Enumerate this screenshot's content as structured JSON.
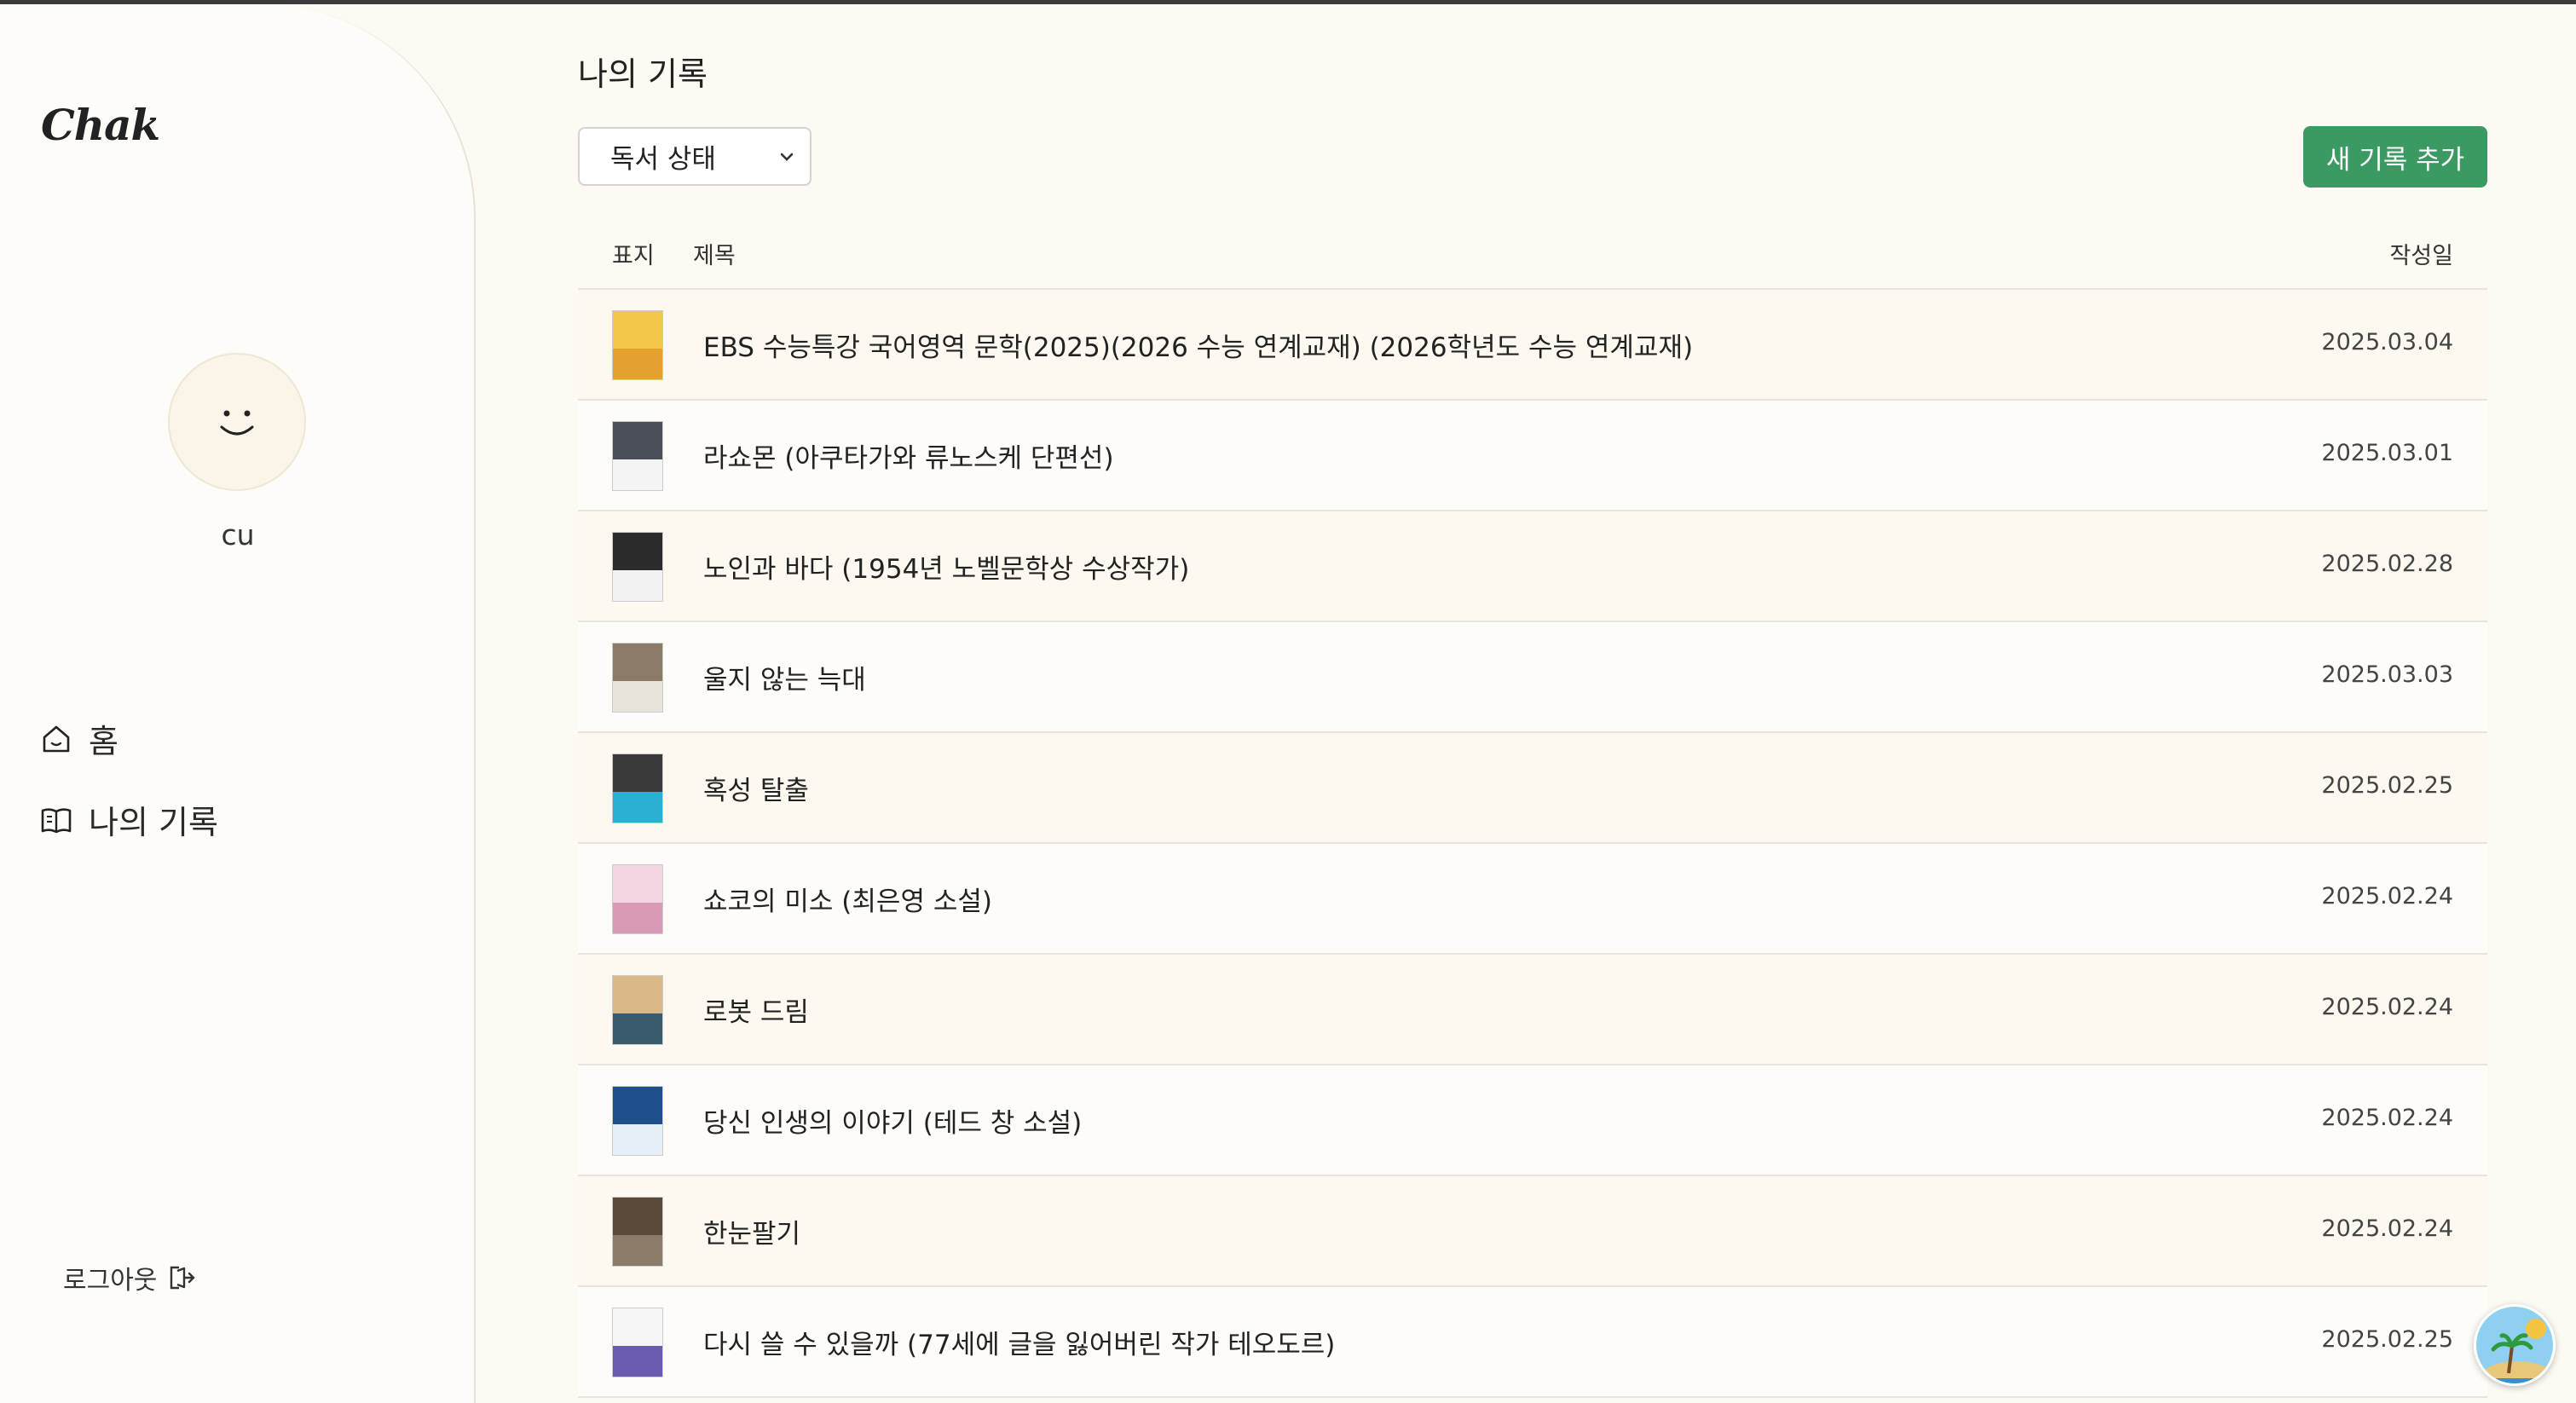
{
  "app": {
    "logo": "Chak"
  },
  "sidebar": {
    "username": "cu",
    "nav": [
      {
        "label": "홈",
        "icon": "home-icon"
      },
      {
        "label": "나의 기록",
        "icon": "book-open-icon"
      }
    ],
    "logout_label": "로그아웃"
  },
  "main": {
    "title": "나의 기록",
    "filter": {
      "selected": "독서 상태"
    },
    "add_button": "새 기록 추가",
    "columns": {
      "cover": "표지",
      "title": "제목",
      "date": "작성일"
    },
    "rows": [
      {
        "title": "EBS 수능특강 국어영역 문학(2025)(2026 수능 연계교재) (2026학년도 수능 연계교재)",
        "date": "2025.03.04",
        "cover_colors": [
          "#f2c84b",
          "#e3a12f"
        ]
      },
      {
        "title": "라쇼몬 (아쿠타가와 류노스케 단편선)",
        "date": "2025.03.01",
        "cover_colors": [
          "#4b4f5a",
          "#f4f4f4"
        ]
      },
      {
        "title": "노인과 바다 (1954년 노벨문학상 수상작가)",
        "date": "2025.02.28",
        "cover_colors": [
          "#2b2b2b",
          "#f2f2f2"
        ]
      },
      {
        "title": "울지 않는 늑대",
        "date": "2025.03.03",
        "cover_colors": [
          "#8a7a66",
          "#e9e4da"
        ]
      },
      {
        "title": "혹성 탈출",
        "date": "2025.02.25",
        "cover_colors": [
          "#3a3a3a",
          "#2bb0d4"
        ]
      },
      {
        "title": "쇼코의 미소 (최은영 소설)",
        "date": "2025.02.24",
        "cover_colors": [
          "#f3d6e2",
          "#d99ab5"
        ]
      },
      {
        "title": "로봇 드림",
        "date": "2025.02.24",
        "cover_colors": [
          "#d9b887",
          "#3a5b6e"
        ]
      },
      {
        "title": "당신 인생의 이야기 (테드 창 소설)",
        "date": "2025.02.24",
        "cover_colors": [
          "#1f4f8a",
          "#e6eef7"
        ]
      },
      {
        "title": "한눈팔기",
        "date": "2025.02.24",
        "cover_colors": [
          "#5a4a3a",
          "#8c7b68"
        ]
      },
      {
        "title": "다시 쓸 수 있을까 (77세에 글을 잃어버린 작가 테오도르)",
        "date": "2025.02.25",
        "cover_colors": [
          "#f5f5f5",
          "#6a5ab0"
        ]
      }
    ]
  },
  "theme": {
    "accent": "#3a9a62",
    "background": "#fdfaf4"
  }
}
